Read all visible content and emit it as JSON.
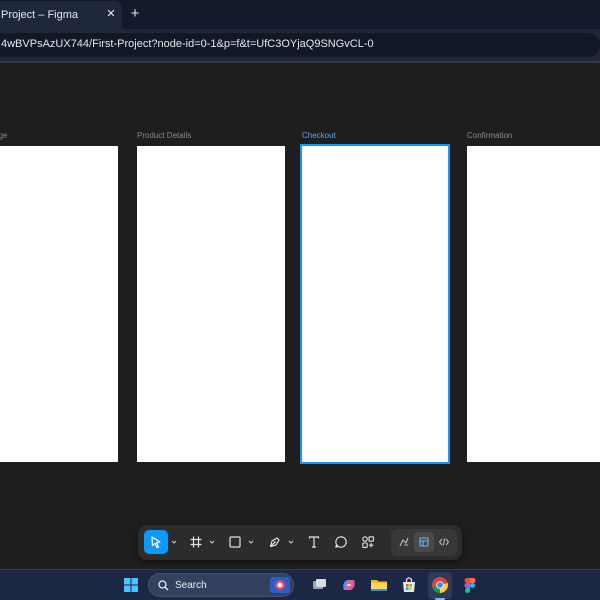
{
  "browser": {
    "tab_title": "Project – Figma",
    "tab_close_icon": "close-icon",
    "new_tab_icon": "plus-icon",
    "url": "4wBVPsAzUX744/First-Project?node-id=0-1&p=f&t=UfC3OYjaQ9SNGvCL-0"
  },
  "canvas": {
    "frames": [
      {
        "label": "age"
      },
      {
        "label": "Product Details"
      },
      {
        "label": "Checkout",
        "selected": true
      },
      {
        "label": "Confirmation"
      }
    ]
  },
  "toolbar": {
    "tools": [
      {
        "name": "move-tool",
        "icon": "cursor-icon",
        "active": true
      },
      {
        "name": "frame-tool",
        "icon": "frame-icon"
      },
      {
        "name": "shape-tool",
        "icon": "rectangle-icon"
      },
      {
        "name": "pen-tool",
        "icon": "pen-icon"
      },
      {
        "name": "text-tool",
        "icon": "text-icon"
      },
      {
        "name": "comment-tool",
        "icon": "comment-icon"
      },
      {
        "name": "actions-tool",
        "icon": "actions-icon"
      }
    ],
    "modes": [
      {
        "name": "draw-mode",
        "icon": "draw-icon"
      },
      {
        "name": "design-mode",
        "icon": "design-icon",
        "active": true
      },
      {
        "name": "dev-mode",
        "icon": "code-icon"
      }
    ],
    "colors": {
      "accent": "#0d99ff"
    }
  },
  "taskbar": {
    "search_label": "Search",
    "apps": [
      "windows-start-icon",
      "task-view-icon",
      "copilot-icon",
      "file-explorer-icon",
      "microsoft-store-icon",
      "chrome-icon",
      "figma-icon"
    ]
  }
}
